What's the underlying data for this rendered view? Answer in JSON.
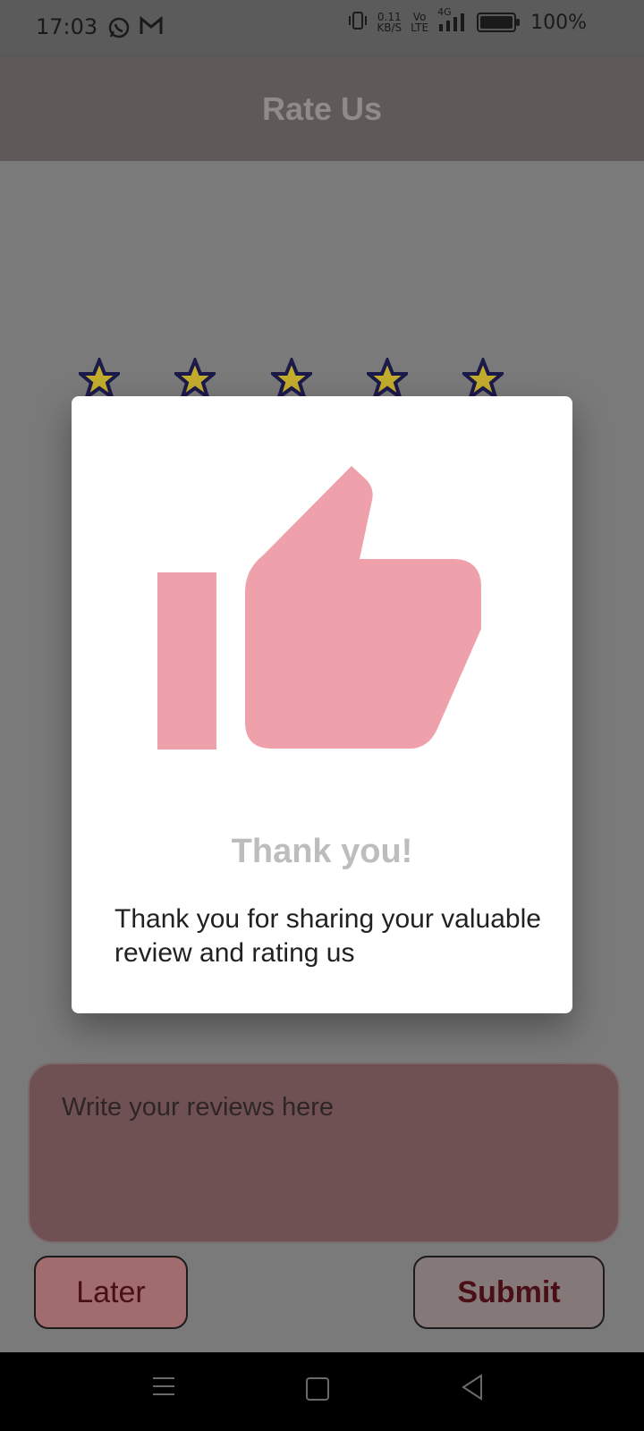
{
  "status": {
    "time": "17:03",
    "network_speed_top": "0.11",
    "network_speed_bottom": "KB/S",
    "volte_top": "Vo",
    "volte_bottom": "LTE",
    "signal_label": "4G",
    "battery_percent": "100%",
    "icons": [
      "whatsapp-icon",
      "gmail-icon",
      "vibrate-icon",
      "signal-icon",
      "battery-icon"
    ]
  },
  "appbar": {
    "title": "Rate Us"
  },
  "rating": {
    "stars_count": 5,
    "star_fill": "#c3ad2d",
    "star_outline": "#1b1a4a"
  },
  "reviews": {
    "placeholder": "Write your reviews here"
  },
  "buttons": {
    "later": "Later",
    "submit": "Submit"
  },
  "dialog": {
    "title": "Thank you!",
    "message": "Thank you for sharing your valuable review and rating us",
    "icon": "thumbs-up-icon",
    "icon_color": "#eea1aa"
  },
  "navbar": {
    "icons": [
      "menu-icon",
      "home-icon",
      "back-icon"
    ]
  }
}
